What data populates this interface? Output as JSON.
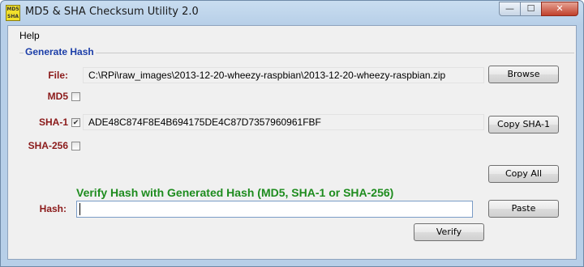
{
  "window": {
    "title": "MD5 & SHA Checksum Utility 2.0",
    "icon_text_top": "MD5",
    "icon_text_bottom": "SHA",
    "minimize_glyph": "—",
    "maximize_glyph": "☐",
    "close_glyph": "✕"
  },
  "menu": {
    "help_label": "Help"
  },
  "generate": {
    "group_title": "Generate Hash",
    "file_label": "File:",
    "file_path": "C:\\RPi\\raw_images\\2013-12-20-wheezy-raspbian\\2013-12-20-wheezy-raspbian.zip",
    "browse_label": "Browse",
    "md5_label": "MD5",
    "md5_checked": false,
    "md5_value": "",
    "sha1_label": "SHA-1",
    "sha1_checked": true,
    "sha1_value": "ADE48C874F8E4B694175DE4C87D7357960961FBF",
    "copy_sha1_label": "Copy SHA-1",
    "sha256_label": "SHA-256",
    "sha256_checked": false,
    "copy_all_label": "Copy All"
  },
  "verify": {
    "heading": "Verify Hash with Generated Hash (MD5, SHA-1 or SHA-256)",
    "hash_label": "Hash:",
    "hash_value": "",
    "paste_label": "Paste",
    "verify_label": "Verify"
  },
  "colors": {
    "label_red": "#8b1a1a",
    "group_title_blue": "#1c3ea8",
    "verify_green": "#1e8c1e"
  }
}
